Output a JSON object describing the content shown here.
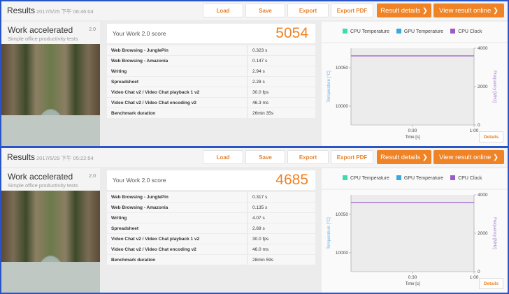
{
  "results": [
    {
      "header": {
        "title": "Results",
        "date": "2017/5/25 下午 06:46:04"
      },
      "buttons": {
        "load": "Load",
        "save": "Save",
        "export": "Export",
        "export_pdf": "Export PDF",
        "result_details": "Result details ❯",
        "view_online": "View result online ❯"
      },
      "test": {
        "name": "Work accelerated",
        "version": "2.0",
        "subtitle": "Simple office productivity tests"
      },
      "score": {
        "label": "Your Work 2.0 score",
        "value": "5054"
      },
      "rows": [
        {
          "name": "Web Browsing - JunglePin",
          "value": "0.323 s"
        },
        {
          "name": "Web Browsing - Amazonia",
          "value": "0.147 s"
        },
        {
          "name": "Writing",
          "value": "2.94 s"
        },
        {
          "name": "Spreadsheet",
          "value": "2.28 s"
        },
        {
          "name": "Video Chat v2 / Video Chat playback 1 v2",
          "value": "30.0 fps"
        },
        {
          "name": "Video Chat v2 / Video Chat encoding v2",
          "value": "46.3 ms"
        },
        {
          "name": "Benchmark duration",
          "value": "26min 35s"
        }
      ],
      "chart": {
        "legend": [
          "CPU Temperature",
          "GPU Temperature",
          "CPU Clock"
        ],
        "left_ticks": [
          "10050",
          "10000"
        ],
        "right_ticks": [
          "4000",
          "2000",
          "0"
        ],
        "x_ticks": [
          "0:30",
          "1:00"
        ],
        "xlabel": "Time [s]",
        "ylabel_left": "Temperature [°C]",
        "ylabel_right": "Frequency [MHz]",
        "cpu_clock_mhz": 3600,
        "details": "Details"
      }
    },
    {
      "header": {
        "title": "Results",
        "date": "2017/5/29 下午 05:22:54"
      },
      "buttons": {
        "load": "Load",
        "save": "Save",
        "export": "Export",
        "export_pdf": "Export PDF",
        "result_details": "Result details ❯",
        "view_online": "View result online ❯"
      },
      "test": {
        "name": "Work accelerated",
        "version": "2.0",
        "subtitle": "Simple office productivity tests"
      },
      "score": {
        "label": "Your Work 2.0 score",
        "value": "4685"
      },
      "rows": [
        {
          "name": "Web Browsing - JunglePin",
          "value": "0.317 s"
        },
        {
          "name": "Web Browsing - Amazonia",
          "value": "0.135 s"
        },
        {
          "name": "Writing",
          "value": "4.07 s"
        },
        {
          "name": "Spreadsheet",
          "value": "2.69 s"
        },
        {
          "name": "Video Chat v2 / Video Chat playback 1 v2",
          "value": "30.0 fps"
        },
        {
          "name": "Video Chat v2 / Video Chat encoding v2",
          "value": "46.0 ms"
        },
        {
          "name": "Benchmark duration",
          "value": "28min 59s"
        }
      ],
      "chart": {
        "legend": [
          "CPU Temperature",
          "GPU Temperature",
          "CPU Clock"
        ],
        "left_ticks": [
          "10050",
          "10000"
        ],
        "right_ticks": [
          "4000",
          "2000",
          "0"
        ],
        "x_ticks": [
          "0:30",
          "1:00"
        ],
        "xlabel": "Time [s]",
        "ylabel_left": "Temperature [°C]",
        "ylabel_right": "Frequency [MHz]",
        "cpu_clock_mhz": 3600,
        "details": "Details"
      }
    }
  ],
  "colors": {
    "accent": "#f08326",
    "cpu_temp": "#3ddbb0",
    "gpu_temp": "#3aa8e0",
    "cpu_clock": "#9b59c9"
  }
}
